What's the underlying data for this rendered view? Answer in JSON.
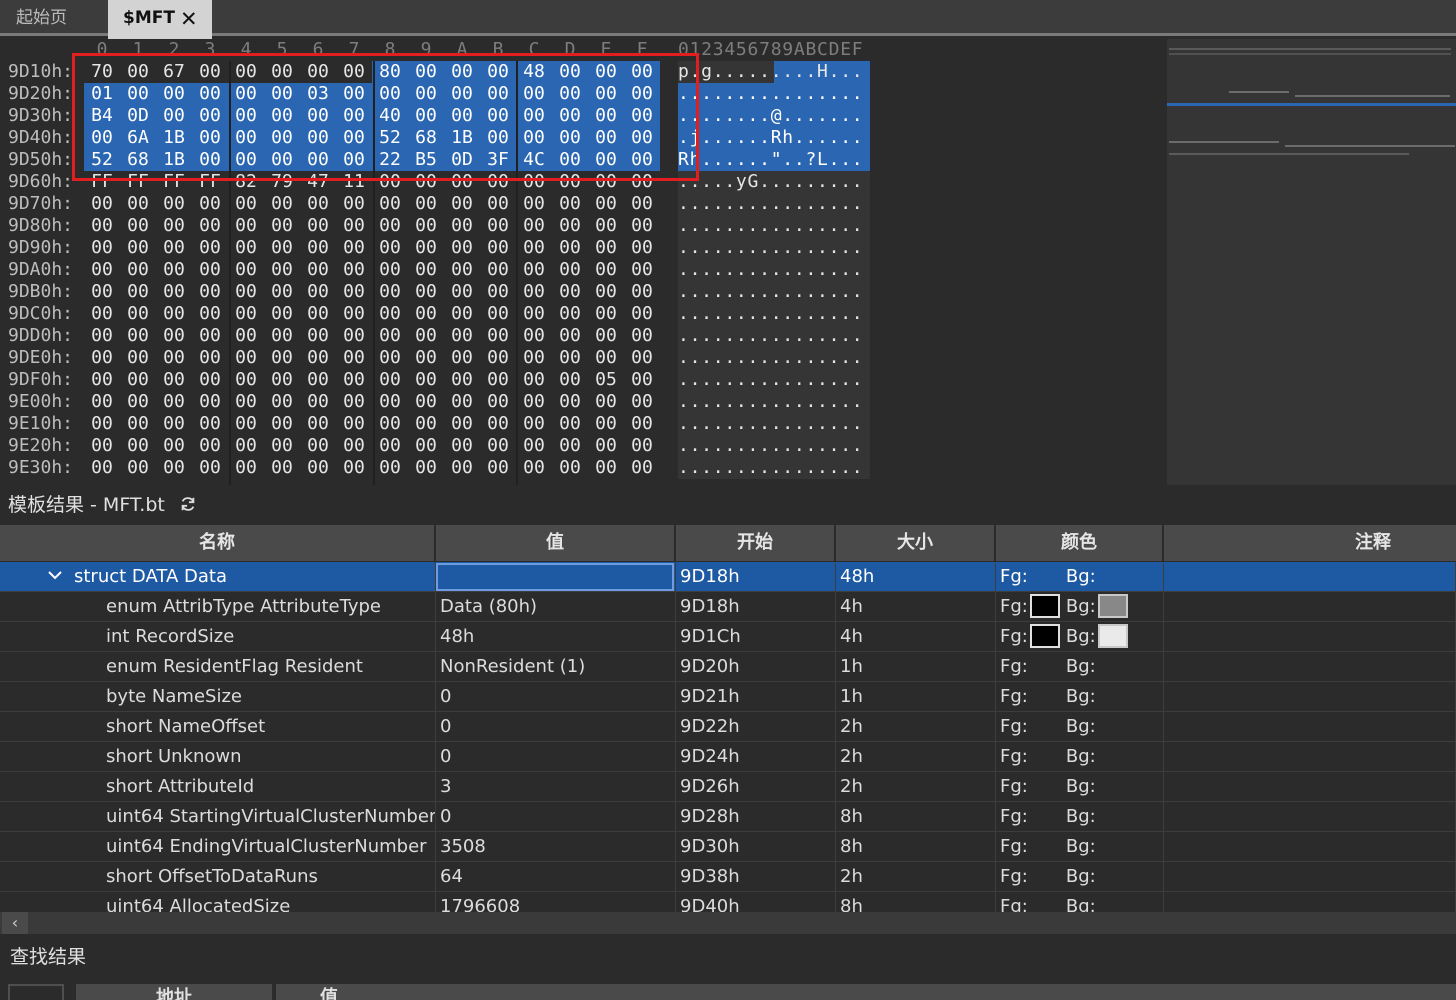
{
  "tabs": {
    "home": "起始页",
    "active": "$MFT"
  },
  "hex": {
    "column_headers": [
      "0",
      "1",
      "2",
      "3",
      "4",
      "5",
      "6",
      "7",
      "8",
      "9",
      "A",
      "B",
      "C",
      "D",
      "E",
      "F"
    ],
    "ascii_header": "0123456789ABCDEF",
    "rows": [
      {
        "addr": "9D10h:",
        "bytes": [
          "70",
          "00",
          "67",
          "00",
          "00",
          "00",
          "00",
          "00",
          "80",
          "00",
          "00",
          "00",
          "48",
          "00",
          "00",
          "00"
        ],
        "ascii": "p.g.........H...",
        "sel_from": 8
      },
      {
        "addr": "9D20h:",
        "bytes": [
          "01",
          "00",
          "00",
          "00",
          "00",
          "00",
          "03",
          "00",
          "00",
          "00",
          "00",
          "00",
          "00",
          "00",
          "00",
          "00"
        ],
        "ascii": "................",
        "sel_from": 0
      },
      {
        "addr": "9D30h:",
        "bytes": [
          "B4",
          "0D",
          "00",
          "00",
          "00",
          "00",
          "00",
          "00",
          "40",
          "00",
          "00",
          "00",
          "00",
          "00",
          "00",
          "00"
        ],
        "ascii": "........@.......",
        "sel_from": 0
      },
      {
        "addr": "9D40h:",
        "bytes": [
          "00",
          "6A",
          "1B",
          "00",
          "00",
          "00",
          "00",
          "00",
          "52",
          "68",
          "1B",
          "00",
          "00",
          "00",
          "00",
          "00"
        ],
        "ascii": ".j......Rh......",
        "sel_from": 0
      },
      {
        "addr": "9D50h:",
        "bytes": [
          "52",
          "68",
          "1B",
          "00",
          "00",
          "00",
          "00",
          "00",
          "22",
          "B5",
          "0D",
          "3F",
          "4C",
          "00",
          "00",
          "00"
        ],
        "ascii": "Rh......\"..?L...",
        "sel_from": 0
      },
      {
        "addr": "9D60h:",
        "bytes": [
          "FF",
          "FF",
          "FF",
          "FF",
          "82",
          "79",
          "47",
          "11",
          "00",
          "00",
          "00",
          "00",
          "00",
          "00",
          "00",
          "00"
        ],
        "ascii": ".....yG.........",
        "sel_from": -1
      },
      {
        "addr": "9D70h:",
        "bytes": [
          "00",
          "00",
          "00",
          "00",
          "00",
          "00",
          "00",
          "00",
          "00",
          "00",
          "00",
          "00",
          "00",
          "00",
          "00",
          "00"
        ],
        "ascii": "................",
        "sel_from": -1
      },
      {
        "addr": "9D80h:",
        "bytes": [
          "00",
          "00",
          "00",
          "00",
          "00",
          "00",
          "00",
          "00",
          "00",
          "00",
          "00",
          "00",
          "00",
          "00",
          "00",
          "00"
        ],
        "ascii": "................",
        "sel_from": -1
      },
      {
        "addr": "9D90h:",
        "bytes": [
          "00",
          "00",
          "00",
          "00",
          "00",
          "00",
          "00",
          "00",
          "00",
          "00",
          "00",
          "00",
          "00",
          "00",
          "00",
          "00"
        ],
        "ascii": "................",
        "sel_from": -1
      },
      {
        "addr": "9DA0h:",
        "bytes": [
          "00",
          "00",
          "00",
          "00",
          "00",
          "00",
          "00",
          "00",
          "00",
          "00",
          "00",
          "00",
          "00",
          "00",
          "00",
          "00"
        ],
        "ascii": "................",
        "sel_from": -1
      },
      {
        "addr": "9DB0h:",
        "bytes": [
          "00",
          "00",
          "00",
          "00",
          "00",
          "00",
          "00",
          "00",
          "00",
          "00",
          "00",
          "00",
          "00",
          "00",
          "00",
          "00"
        ],
        "ascii": "................",
        "sel_from": -1
      },
      {
        "addr": "9DC0h:",
        "bytes": [
          "00",
          "00",
          "00",
          "00",
          "00",
          "00",
          "00",
          "00",
          "00",
          "00",
          "00",
          "00",
          "00",
          "00",
          "00",
          "00"
        ],
        "ascii": "................",
        "sel_from": -1
      },
      {
        "addr": "9DD0h:",
        "bytes": [
          "00",
          "00",
          "00",
          "00",
          "00",
          "00",
          "00",
          "00",
          "00",
          "00",
          "00",
          "00",
          "00",
          "00",
          "00",
          "00"
        ],
        "ascii": "................",
        "sel_from": -1
      },
      {
        "addr": "9DE0h:",
        "bytes": [
          "00",
          "00",
          "00",
          "00",
          "00",
          "00",
          "00",
          "00",
          "00",
          "00",
          "00",
          "00",
          "00",
          "00",
          "00",
          "00"
        ],
        "ascii": "................",
        "sel_from": -1
      },
      {
        "addr": "9DF0h:",
        "bytes": [
          "00",
          "00",
          "00",
          "00",
          "00",
          "00",
          "00",
          "00",
          "00",
          "00",
          "00",
          "00",
          "00",
          "00",
          "05",
          "00"
        ],
        "ascii": "................",
        "sel_from": -1
      },
      {
        "addr": "9E00h:",
        "bytes": [
          "00",
          "00",
          "00",
          "00",
          "00",
          "00",
          "00",
          "00",
          "00",
          "00",
          "00",
          "00",
          "00",
          "00",
          "00",
          "00"
        ],
        "ascii": "................",
        "sel_from": -1
      },
      {
        "addr": "9E10h:",
        "bytes": [
          "00",
          "00",
          "00",
          "00",
          "00",
          "00",
          "00",
          "00",
          "00",
          "00",
          "00",
          "00",
          "00",
          "00",
          "00",
          "00"
        ],
        "ascii": "................",
        "sel_from": -1
      },
      {
        "addr": "9E20h:",
        "bytes": [
          "00",
          "00",
          "00",
          "00",
          "00",
          "00",
          "00",
          "00",
          "00",
          "00",
          "00",
          "00",
          "00",
          "00",
          "00",
          "00"
        ],
        "ascii": "................",
        "sel_from": -1
      },
      {
        "addr": "9E30h:",
        "bytes": [
          "00",
          "00",
          "00",
          "00",
          "00",
          "00",
          "00",
          "00",
          "00",
          "00",
          "00",
          "00",
          "00",
          "00",
          "00",
          "00"
        ],
        "ascii": "................",
        "sel_from": -1
      }
    ],
    "selection_color": "#2a66b1",
    "annotation_color": "#e21f1f"
  },
  "template_panel": {
    "title": "模板结果 - MFT.bt",
    "columns": {
      "name": "名称",
      "value": "值",
      "start": "开始",
      "size": "大小",
      "color": "颜色",
      "comment": "注释"
    },
    "rows": [
      {
        "name": "struct DATA Data",
        "value": "",
        "start": "9D18h",
        "size": "48h",
        "fg": "Fg:",
        "bg": "Bg:",
        "comment": "",
        "fg_swatch": "",
        "bg_swatch": ""
      },
      {
        "name": "enum AttribType AttributeType",
        "value": "Data (80h)",
        "start": "9D18h",
        "size": "4h",
        "fg": "Fg:",
        "bg": "Bg:",
        "comment": "",
        "fg_swatch": "black",
        "bg_swatch": "gray"
      },
      {
        "name": "int RecordSize",
        "value": "48h",
        "start": "9D1Ch",
        "size": "4h",
        "fg": "Fg:",
        "bg": "Bg:",
        "comment": "",
        "fg_swatch": "black",
        "bg_swatch": "white"
      },
      {
        "name": "enum ResidentFlag Resident",
        "value": "NonResident (1)",
        "start": "9D20h",
        "size": "1h",
        "fg": "Fg:",
        "bg": "Bg:",
        "comment": "",
        "fg_swatch": "",
        "bg_swatch": ""
      },
      {
        "name": "byte NameSize",
        "value": "0",
        "start": "9D21h",
        "size": "1h",
        "fg": "Fg:",
        "bg": "Bg:",
        "comment": "",
        "fg_swatch": "",
        "bg_swatch": ""
      },
      {
        "name": "short NameOffset",
        "value": "0",
        "start": "9D22h",
        "size": "2h",
        "fg": "Fg:",
        "bg": "Bg:",
        "comment": "",
        "fg_swatch": "",
        "bg_swatch": ""
      },
      {
        "name": "short Unknown",
        "value": "0",
        "start": "9D24h",
        "size": "2h",
        "fg": "Fg:",
        "bg": "Bg:",
        "comment": "",
        "fg_swatch": "",
        "bg_swatch": ""
      },
      {
        "name": "short AttributeId",
        "value": "3",
        "start": "9D26h",
        "size": "2h",
        "fg": "Fg:",
        "bg": "Bg:",
        "comment": "",
        "fg_swatch": "",
        "bg_swatch": ""
      },
      {
        "name": "uint64 StartingVirtualClusterNumber",
        "value": "0",
        "start": "9D28h",
        "size": "8h",
        "fg": "Fg:",
        "bg": "Bg:",
        "comment": "",
        "fg_swatch": "",
        "bg_swatch": ""
      },
      {
        "name": "uint64 EndingVirtualClusterNumber",
        "value": "3508",
        "start": "9D30h",
        "size": "8h",
        "fg": "Fg:",
        "bg": "Bg:",
        "comment": "",
        "fg_swatch": "",
        "bg_swatch": ""
      },
      {
        "name": "short OffsetToDataRuns",
        "value": "64",
        "start": "9D38h",
        "size": "2h",
        "fg": "Fg:",
        "bg": "Bg:",
        "comment": "",
        "fg_swatch": "",
        "bg_swatch": ""
      },
      {
        "name": "uint64 AllocatedSize",
        "value": "1796608",
        "start": "9D40h",
        "size": "8h",
        "fg": "Fg:",
        "bg": "Bg:",
        "comment": "",
        "fg_swatch": "",
        "bg_swatch": ""
      }
    ]
  },
  "search_panel": {
    "title": "查找结果",
    "columns": {
      "address": "地址",
      "value": "值"
    }
  },
  "icons": {
    "tab_close": "close-icon",
    "refresh": "refresh-icon",
    "expand": "chevron-down-icon",
    "scroll_left": "chevron-left-icon"
  }
}
